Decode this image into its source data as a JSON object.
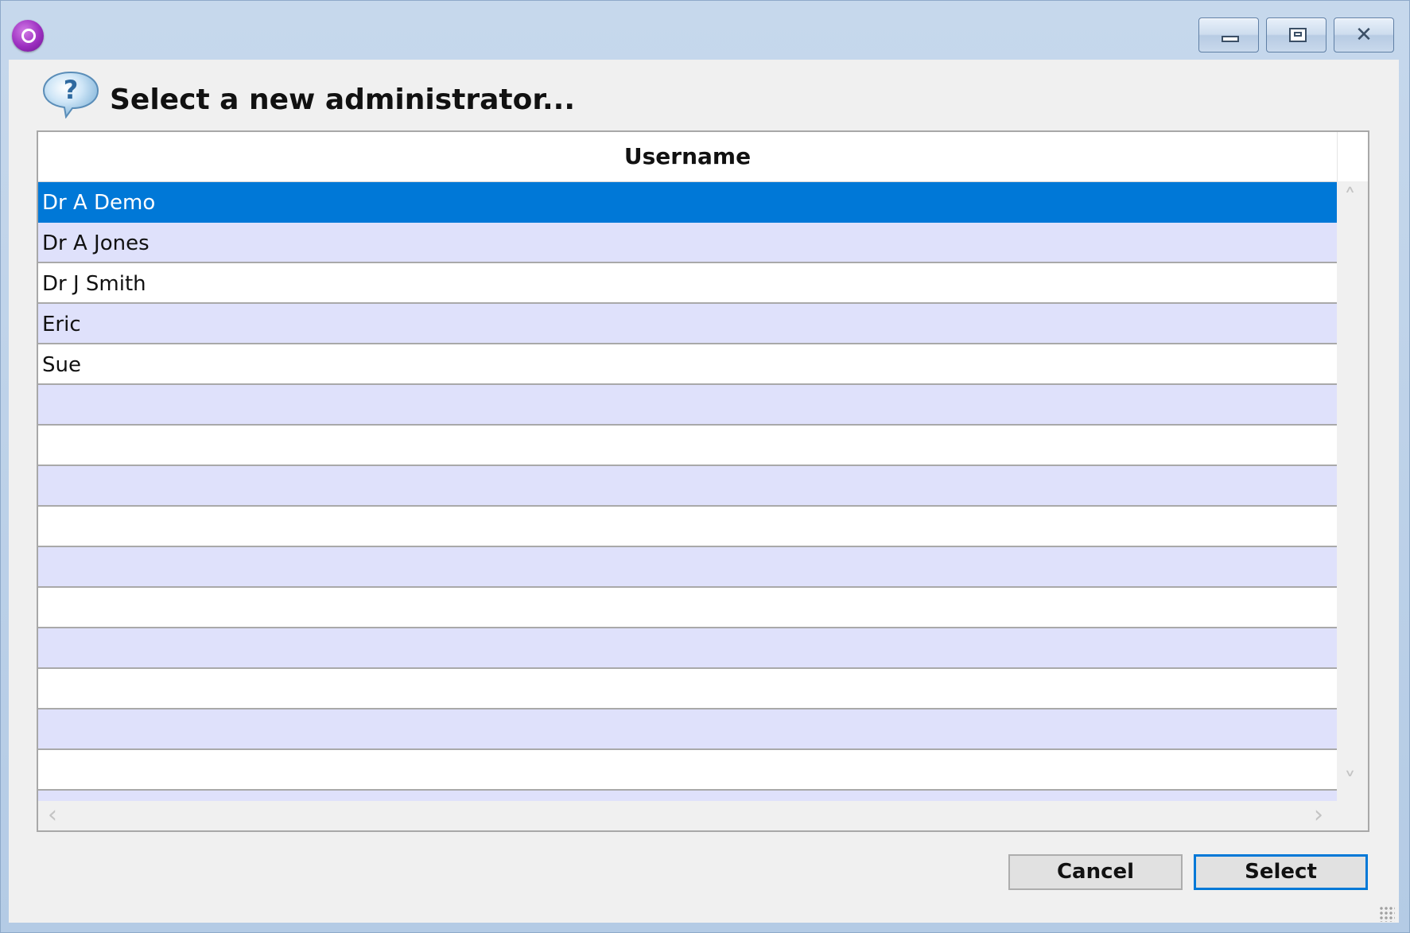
{
  "window": {
    "app_icon": "purple-app-icon",
    "controls": {
      "minimize_icon": "minimize-icon",
      "maximize_icon": "maximize-icon",
      "close_icon": "close-icon",
      "close_glyph": "✕"
    }
  },
  "dialog": {
    "icon": "help-question-icon",
    "title": "Select a new administrator..."
  },
  "grid": {
    "columns": [
      "Username"
    ],
    "rows": [
      "Dr A Demo",
      "Dr A Jones",
      "Dr J Smith",
      "Eric",
      "Sue",
      "",
      "",
      "",
      "",
      "",
      "",
      "",
      "",
      "",
      "",
      ""
    ],
    "selected_index": 0,
    "scroll_icons": {
      "up": "chevron-up-icon",
      "down": "chevron-down-icon",
      "left": "chevron-left-icon",
      "right": "chevron-right-icon"
    },
    "colors": {
      "selected": "#0078d7",
      "alt_row": "#dfe1fb"
    }
  },
  "buttons": {
    "cancel": "Cancel",
    "select": "Select"
  }
}
